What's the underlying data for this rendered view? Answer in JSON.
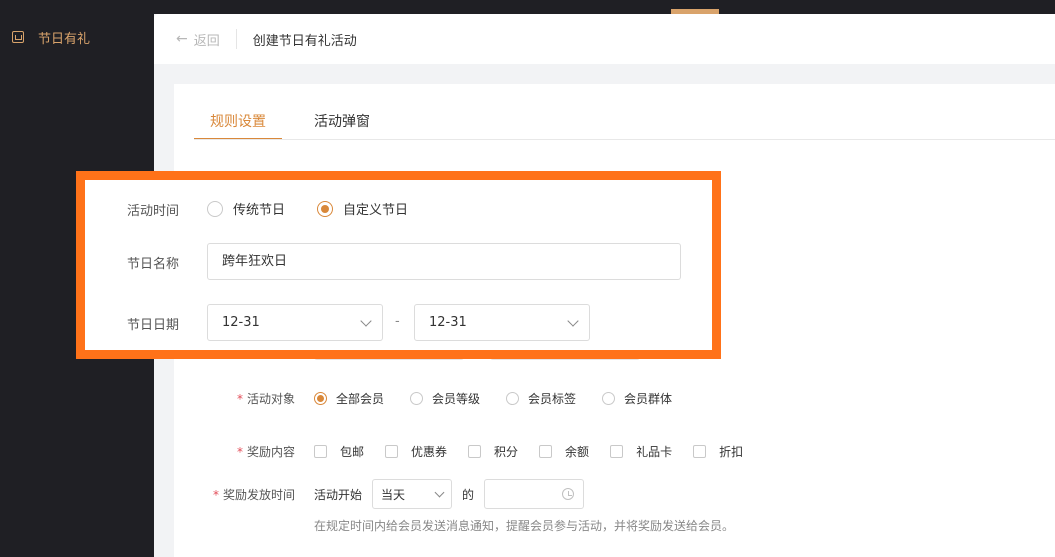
{
  "sidebar": {
    "item_label": "节日有礼",
    "icon": "gift-icon"
  },
  "header": {
    "back_label": "返回",
    "title": "创建节日有礼活动"
  },
  "tabs": [
    {
      "label": "规则设置",
      "active": true
    },
    {
      "label": "活动弹窗",
      "active": false
    }
  ],
  "form": {
    "target": {
      "label": "活动对象",
      "options": [
        {
          "label": "全部会员",
          "checked": true
        },
        {
          "label": "会员等级",
          "checked": false
        },
        {
          "label": "会员标签",
          "checked": false
        },
        {
          "label": "会员群体",
          "checked": false
        }
      ]
    },
    "rewards": {
      "label": "奖励内容",
      "options": [
        {
          "label": "包邮",
          "checked": false
        },
        {
          "label": "优惠券",
          "checked": false
        },
        {
          "label": "积分",
          "checked": false
        },
        {
          "label": "余额",
          "checked": false
        },
        {
          "label": "礼品卡",
          "checked": false
        },
        {
          "label": "折扣",
          "checked": false
        }
      ]
    },
    "send_time": {
      "label": "奖励发放时间",
      "prefix": "活动开始",
      "select_value": "当天",
      "suffix": "的",
      "time_value": "",
      "hint": "在规定时间内给会员发送消息通知，提醒会员参与活动，并将奖励发送给会员。"
    }
  },
  "overlay": {
    "time_label": "活动时间",
    "time_options": [
      {
        "label": "传统节日",
        "checked": false
      },
      {
        "label": "自定义节日",
        "checked": true
      }
    ],
    "name_label": "节日名称",
    "name_value": "跨年狂欢日",
    "date_label": "节日日期",
    "date_start": "12-31",
    "date_separator": "-",
    "date_end": "12-31"
  },
  "colors": {
    "accent": "#d9883a",
    "highlight_border": "#ff7219",
    "sidebar_bg": "#1f1f24"
  }
}
